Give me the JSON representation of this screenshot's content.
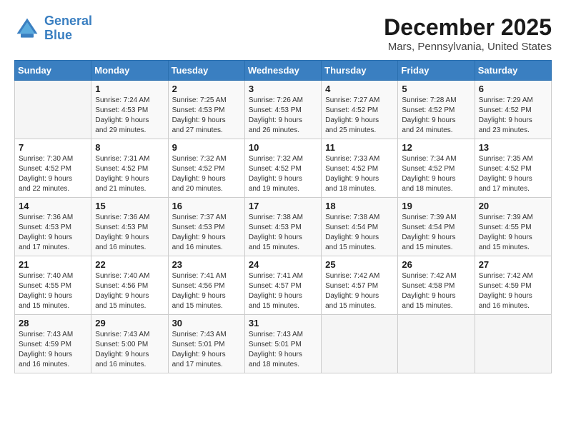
{
  "header": {
    "logo_line1": "General",
    "logo_line2": "Blue",
    "month": "December 2025",
    "location": "Mars, Pennsylvania, United States"
  },
  "days_of_week": [
    "Sunday",
    "Monday",
    "Tuesday",
    "Wednesday",
    "Thursday",
    "Friday",
    "Saturday"
  ],
  "weeks": [
    [
      {
        "day": "",
        "content": ""
      },
      {
        "day": "1",
        "content": "Sunrise: 7:24 AM\nSunset: 4:53 PM\nDaylight: 9 hours\nand 29 minutes."
      },
      {
        "day": "2",
        "content": "Sunrise: 7:25 AM\nSunset: 4:53 PM\nDaylight: 9 hours\nand 27 minutes."
      },
      {
        "day": "3",
        "content": "Sunrise: 7:26 AM\nSunset: 4:53 PM\nDaylight: 9 hours\nand 26 minutes."
      },
      {
        "day": "4",
        "content": "Sunrise: 7:27 AM\nSunset: 4:52 PM\nDaylight: 9 hours\nand 25 minutes."
      },
      {
        "day": "5",
        "content": "Sunrise: 7:28 AM\nSunset: 4:52 PM\nDaylight: 9 hours\nand 24 minutes."
      },
      {
        "day": "6",
        "content": "Sunrise: 7:29 AM\nSunset: 4:52 PM\nDaylight: 9 hours\nand 23 minutes."
      }
    ],
    [
      {
        "day": "7",
        "content": "Sunrise: 7:30 AM\nSunset: 4:52 PM\nDaylight: 9 hours\nand 22 minutes."
      },
      {
        "day": "8",
        "content": "Sunrise: 7:31 AM\nSunset: 4:52 PM\nDaylight: 9 hours\nand 21 minutes."
      },
      {
        "day": "9",
        "content": "Sunrise: 7:32 AM\nSunset: 4:52 PM\nDaylight: 9 hours\nand 20 minutes."
      },
      {
        "day": "10",
        "content": "Sunrise: 7:32 AM\nSunset: 4:52 PM\nDaylight: 9 hours\nand 19 minutes."
      },
      {
        "day": "11",
        "content": "Sunrise: 7:33 AM\nSunset: 4:52 PM\nDaylight: 9 hours\nand 18 minutes."
      },
      {
        "day": "12",
        "content": "Sunrise: 7:34 AM\nSunset: 4:52 PM\nDaylight: 9 hours\nand 18 minutes."
      },
      {
        "day": "13",
        "content": "Sunrise: 7:35 AM\nSunset: 4:52 PM\nDaylight: 9 hours\nand 17 minutes."
      }
    ],
    [
      {
        "day": "14",
        "content": "Sunrise: 7:36 AM\nSunset: 4:53 PM\nDaylight: 9 hours\nand 17 minutes."
      },
      {
        "day": "15",
        "content": "Sunrise: 7:36 AM\nSunset: 4:53 PM\nDaylight: 9 hours\nand 16 minutes."
      },
      {
        "day": "16",
        "content": "Sunrise: 7:37 AM\nSunset: 4:53 PM\nDaylight: 9 hours\nand 16 minutes."
      },
      {
        "day": "17",
        "content": "Sunrise: 7:38 AM\nSunset: 4:53 PM\nDaylight: 9 hours\nand 15 minutes."
      },
      {
        "day": "18",
        "content": "Sunrise: 7:38 AM\nSunset: 4:54 PM\nDaylight: 9 hours\nand 15 minutes."
      },
      {
        "day": "19",
        "content": "Sunrise: 7:39 AM\nSunset: 4:54 PM\nDaylight: 9 hours\nand 15 minutes."
      },
      {
        "day": "20",
        "content": "Sunrise: 7:39 AM\nSunset: 4:55 PM\nDaylight: 9 hours\nand 15 minutes."
      }
    ],
    [
      {
        "day": "21",
        "content": "Sunrise: 7:40 AM\nSunset: 4:55 PM\nDaylight: 9 hours\nand 15 minutes."
      },
      {
        "day": "22",
        "content": "Sunrise: 7:40 AM\nSunset: 4:56 PM\nDaylight: 9 hours\nand 15 minutes."
      },
      {
        "day": "23",
        "content": "Sunrise: 7:41 AM\nSunset: 4:56 PM\nDaylight: 9 hours\nand 15 minutes."
      },
      {
        "day": "24",
        "content": "Sunrise: 7:41 AM\nSunset: 4:57 PM\nDaylight: 9 hours\nand 15 minutes."
      },
      {
        "day": "25",
        "content": "Sunrise: 7:42 AM\nSunset: 4:57 PM\nDaylight: 9 hours\nand 15 minutes."
      },
      {
        "day": "26",
        "content": "Sunrise: 7:42 AM\nSunset: 4:58 PM\nDaylight: 9 hours\nand 15 minutes."
      },
      {
        "day": "27",
        "content": "Sunrise: 7:42 AM\nSunset: 4:59 PM\nDaylight: 9 hours\nand 16 minutes."
      }
    ],
    [
      {
        "day": "28",
        "content": "Sunrise: 7:43 AM\nSunset: 4:59 PM\nDaylight: 9 hours\nand 16 minutes."
      },
      {
        "day": "29",
        "content": "Sunrise: 7:43 AM\nSunset: 5:00 PM\nDaylight: 9 hours\nand 16 minutes."
      },
      {
        "day": "30",
        "content": "Sunrise: 7:43 AM\nSunset: 5:01 PM\nDaylight: 9 hours\nand 17 minutes."
      },
      {
        "day": "31",
        "content": "Sunrise: 7:43 AM\nSunset: 5:01 PM\nDaylight: 9 hours\nand 18 minutes."
      },
      {
        "day": "",
        "content": ""
      },
      {
        "day": "",
        "content": ""
      },
      {
        "day": "",
        "content": ""
      }
    ]
  ]
}
